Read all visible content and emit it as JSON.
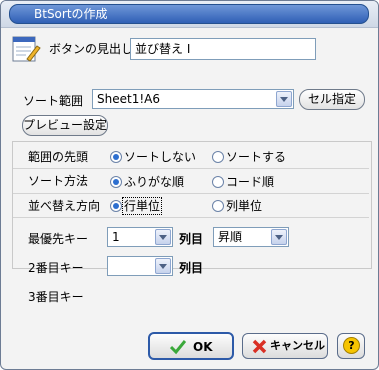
{
  "window": {
    "title": "BtSortの作成"
  },
  "caption": {
    "label": "ボタンの見出し",
    "value": "並び替え I"
  },
  "sort_range": {
    "label": "ソート範囲",
    "value": "Sheet1!A6",
    "cell_button": "セル指定"
  },
  "preview_button": "プレビュー設定",
  "header_row": {
    "label": "範囲の先頭",
    "options": [
      "ソートしない",
      "ソートする"
    ],
    "selected": "ソートしない"
  },
  "sort_method": {
    "label": "ソート方法",
    "options": [
      "ふりがな順",
      "コード順"
    ],
    "selected": "ふりがな順"
  },
  "sort_direction": {
    "label": "並べ替え方向",
    "options": [
      "行単位",
      "列単位"
    ],
    "selected": "行単位"
  },
  "keys": {
    "first": {
      "label": "最優先キー",
      "value": "1",
      "unit": "列目",
      "order": "昇順"
    },
    "second": {
      "label": "2番目キー",
      "value": "",
      "unit": "列目"
    },
    "third": {
      "label": "3番目キー"
    }
  },
  "buttons": {
    "ok": "OK",
    "cancel": "キャンセル",
    "help": "?"
  },
  "colors": {
    "title_bar": "#3c68bd",
    "ok_check": "#3aa83a",
    "cancel_x": "#d93025",
    "help_badge": "#f6c400"
  },
  "icons": {
    "title": "app-icon",
    "caption": "edit-document-icon",
    "ok": "checkmark-icon",
    "cancel": "x-icon",
    "help": "question-icon"
  }
}
